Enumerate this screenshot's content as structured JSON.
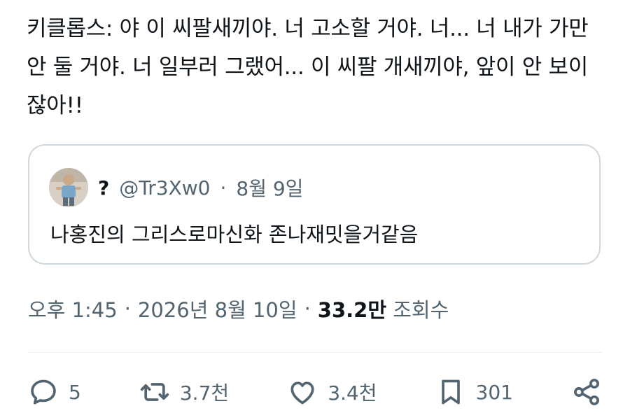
{
  "tweet": {
    "text": "키클롭스: 야 이 씨팔새끼야. 너 고소할 거야. 너... 너 내가 가만 안 둘 거야. 너 일부러 그랬어... 이 씨팔 개새끼야, 앞이 안 보이잖아!!"
  },
  "quote": {
    "name": "?",
    "handle": "@Tr3Xw0",
    "separator": "·",
    "date": "8월 9일",
    "text": "나홍진의 그리스로마신화 존나재밋을거같음"
  },
  "meta": {
    "time": "오후 1:45",
    "sep1": "·",
    "date": "2026년 8월 10일",
    "sep2": "·",
    "views_count": "33.2만",
    "views_label": "조회수"
  },
  "actions": {
    "reply_icon": "speech-bubble",
    "reply_count": "5",
    "retweet_icon": "retweet-arrows",
    "retweet_count": "3.7천",
    "like_icon": "heart",
    "like_count": "3.4천",
    "bookmark_icon": "bookmark",
    "bookmark_count": "301",
    "share_icon": "share-nodes"
  },
  "colors": {
    "text_primary": "#0f1419",
    "text_secondary": "#536471",
    "border": "#cfd9de"
  }
}
